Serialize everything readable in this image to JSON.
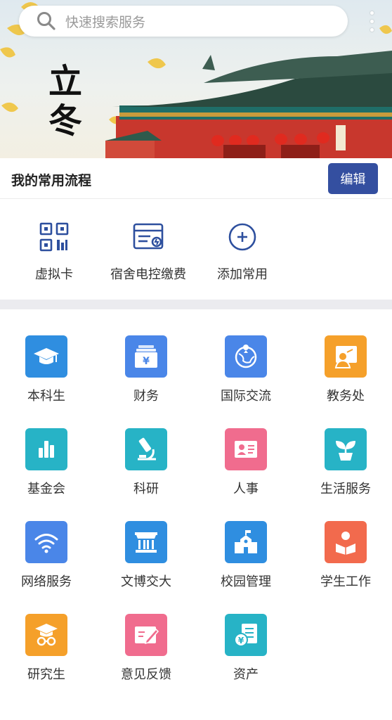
{
  "search": {
    "placeholder": "快速搜索服务"
  },
  "banner": {
    "season_text": "立冬"
  },
  "common": {
    "title": "我的常用流程",
    "edit_label": "编辑",
    "items": [
      {
        "label": "虚拟卡",
        "icon": "qr-code-icon"
      },
      {
        "label": "宿舍电控缴费",
        "icon": "electric-bill-icon"
      },
      {
        "label": "添加常用",
        "icon": "add-circle-icon"
      }
    ]
  },
  "services": [
    {
      "label": "本科生",
      "icon": "graduation-cap-icon",
      "color": "#2f8ee0"
    },
    {
      "label": "财务",
      "icon": "finance-yen-icon",
      "color": "#4a86e8"
    },
    {
      "label": "国际交流",
      "icon": "globe-icon",
      "color": "#4a86e8"
    },
    {
      "label": "教务处",
      "icon": "teacher-board-icon",
      "color": "#f5a02a"
    },
    {
      "label": "基金会",
      "icon": "bar-chart-icon",
      "color": "#27b3c6"
    },
    {
      "label": "科研",
      "icon": "microscope-icon",
      "color": "#27b3c6"
    },
    {
      "label": "人事",
      "icon": "id-card-icon",
      "color": "#f06c8e"
    },
    {
      "label": "生活服务",
      "icon": "plant-icon",
      "color": "#27b3c6"
    },
    {
      "label": "网络服务",
      "icon": "wifi-icon",
      "color": "#4a86e8"
    },
    {
      "label": "文博交大",
      "icon": "museum-icon",
      "color": "#2f8ee0"
    },
    {
      "label": "校园管理",
      "icon": "school-building-icon",
      "color": "#2f8ee0"
    },
    {
      "label": "学生工作",
      "icon": "student-reading-icon",
      "color": "#f26a4d"
    },
    {
      "label": "研究生",
      "icon": "graduate-glasses-icon",
      "color": "#f5a02a"
    },
    {
      "label": "意见反馈",
      "icon": "feedback-pen-icon",
      "color": "#f06c8e"
    },
    {
      "label": "资产",
      "icon": "asset-document-icon",
      "color": "#27b3c6"
    }
  ]
}
